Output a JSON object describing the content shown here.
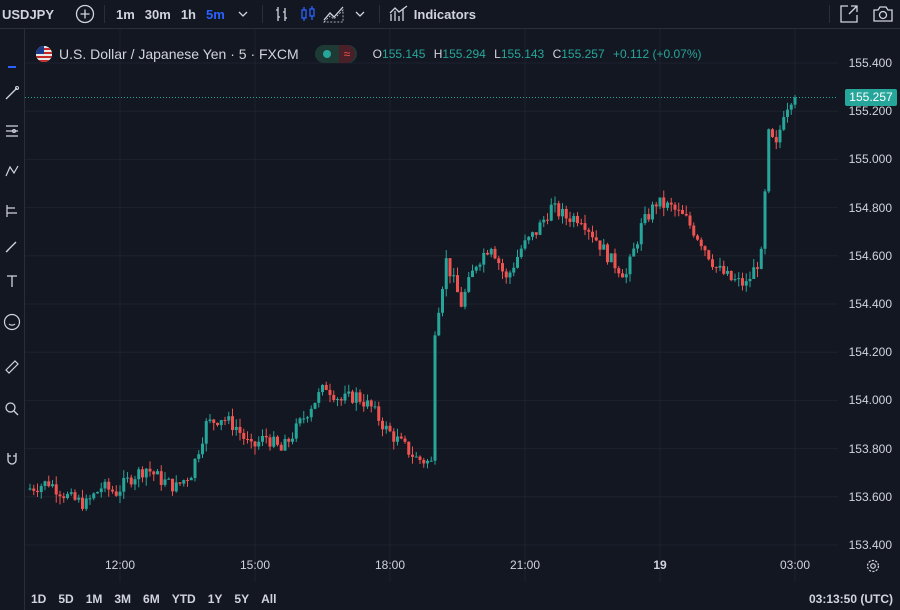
{
  "toolbar": {
    "symbol": "USDJPY",
    "timeframes": [
      "1m",
      "30m",
      "1h",
      "5m"
    ],
    "active_timeframe": "5m",
    "indicators_label": "Indicators"
  },
  "legend": {
    "title": "U.S. Dollar / Japanese Yen · 5 · FXCM",
    "o_label": "O",
    "o_value": "155.145",
    "h_label": "H",
    "h_value": "155.294",
    "l_label": "L",
    "l_value": "155.143",
    "c_label": "C",
    "c_value": "155.257",
    "change": "+0.112 (+0.07%)"
  },
  "last_price": "155.257",
  "price_axis": [
    "155.400",
    "155.200",
    "155.000",
    "154.800",
    "154.600",
    "154.400",
    "154.200",
    "154.000",
    "153.800",
    "153.600",
    "153.400"
  ],
  "time_axis": [
    "12:00",
    "15:00",
    "18:00",
    "21:00",
    "19",
    "03:00"
  ],
  "ranges": [
    "1D",
    "5D",
    "1M",
    "3M",
    "6M",
    "YTD",
    "1Y",
    "5Y",
    "All"
  ],
  "clock": "03:13:50 (UTC)",
  "colors": {
    "up": "#26a69a",
    "down": "#ef5350",
    "background": "#131722",
    "active": "#2962ff"
  },
  "chart_data": {
    "type": "candlestick",
    "title": "U.S. Dollar / Japanese Yen · 5 · FXCM",
    "xlabel": "",
    "ylabel": "",
    "ylim": [
      153.35,
      155.45
    ],
    "grid": true,
    "x_ticks": [
      "12:00",
      "15:00",
      "18:00",
      "21:00",
      "19",
      "03:00"
    ],
    "close_path": [
      [
        "10:00",
        153.63
      ],
      [
        "10:30",
        153.66
      ],
      [
        "11:00",
        153.59
      ],
      [
        "11:20",
        153.57
      ],
      [
        "11:40",
        153.64
      ],
      [
        "12:00",
        153.62
      ],
      [
        "12:20",
        153.68
      ],
      [
        "12:40",
        153.72
      ],
      [
        "13:00",
        153.67
      ],
      [
        "13:20",
        153.64
      ],
      [
        "13:40",
        153.7
      ],
      [
        "14:00",
        153.9
      ],
      [
        "14:20",
        153.93
      ],
      [
        "14:40",
        153.89
      ],
      [
        "15:00",
        153.8
      ],
      [
        "15:20",
        153.85
      ],
      [
        "15:40",
        153.79
      ],
      [
        "16:00",
        153.88
      ],
      [
        "16:20",
        153.98
      ],
      [
        "16:40",
        154.06
      ],
      [
        "17:00",
        154.0
      ],
      [
        "17:20",
        154.02
      ],
      [
        "17:40",
        153.97
      ],
      [
        "18:00",
        153.88
      ],
      [
        "18:20",
        153.82
      ],
      [
        "18:40",
        153.76
      ],
      [
        "19:00",
        153.74
      ],
      [
        "19:05",
        154.3
      ],
      [
        "19:20",
        154.58
      ],
      [
        "19:40",
        154.4
      ],
      [
        "20:00",
        154.57
      ],
      [
        "20:20",
        154.65
      ],
      [
        "20:40",
        154.5
      ],
      [
        "21:00",
        154.63
      ],
      [
        "21:20",
        154.7
      ],
      [
        "21:40",
        154.8
      ],
      [
        "22:00",
        154.76
      ],
      [
        "22:20",
        154.76
      ],
      [
        "22:40",
        154.67
      ],
      [
        "23:00",
        154.58
      ],
      [
        "23:20",
        154.52
      ],
      [
        "23:40",
        154.72
      ],
      [
        "00:00",
        154.82
      ],
      [
        "00:20",
        154.8
      ],
      [
        "00:40",
        154.75
      ],
      [
        "01:00",
        154.66
      ],
      [
        "01:20",
        154.55
      ],
      [
        "01:40",
        154.5
      ],
      [
        "02:00",
        154.48
      ],
      [
        "02:20",
        154.6
      ],
      [
        "02:30",
        155.1
      ],
      [
        "02:40",
        155.05
      ],
      [
        "02:50",
        155.2
      ],
      [
        "03:00",
        155.257
      ]
    ]
  }
}
